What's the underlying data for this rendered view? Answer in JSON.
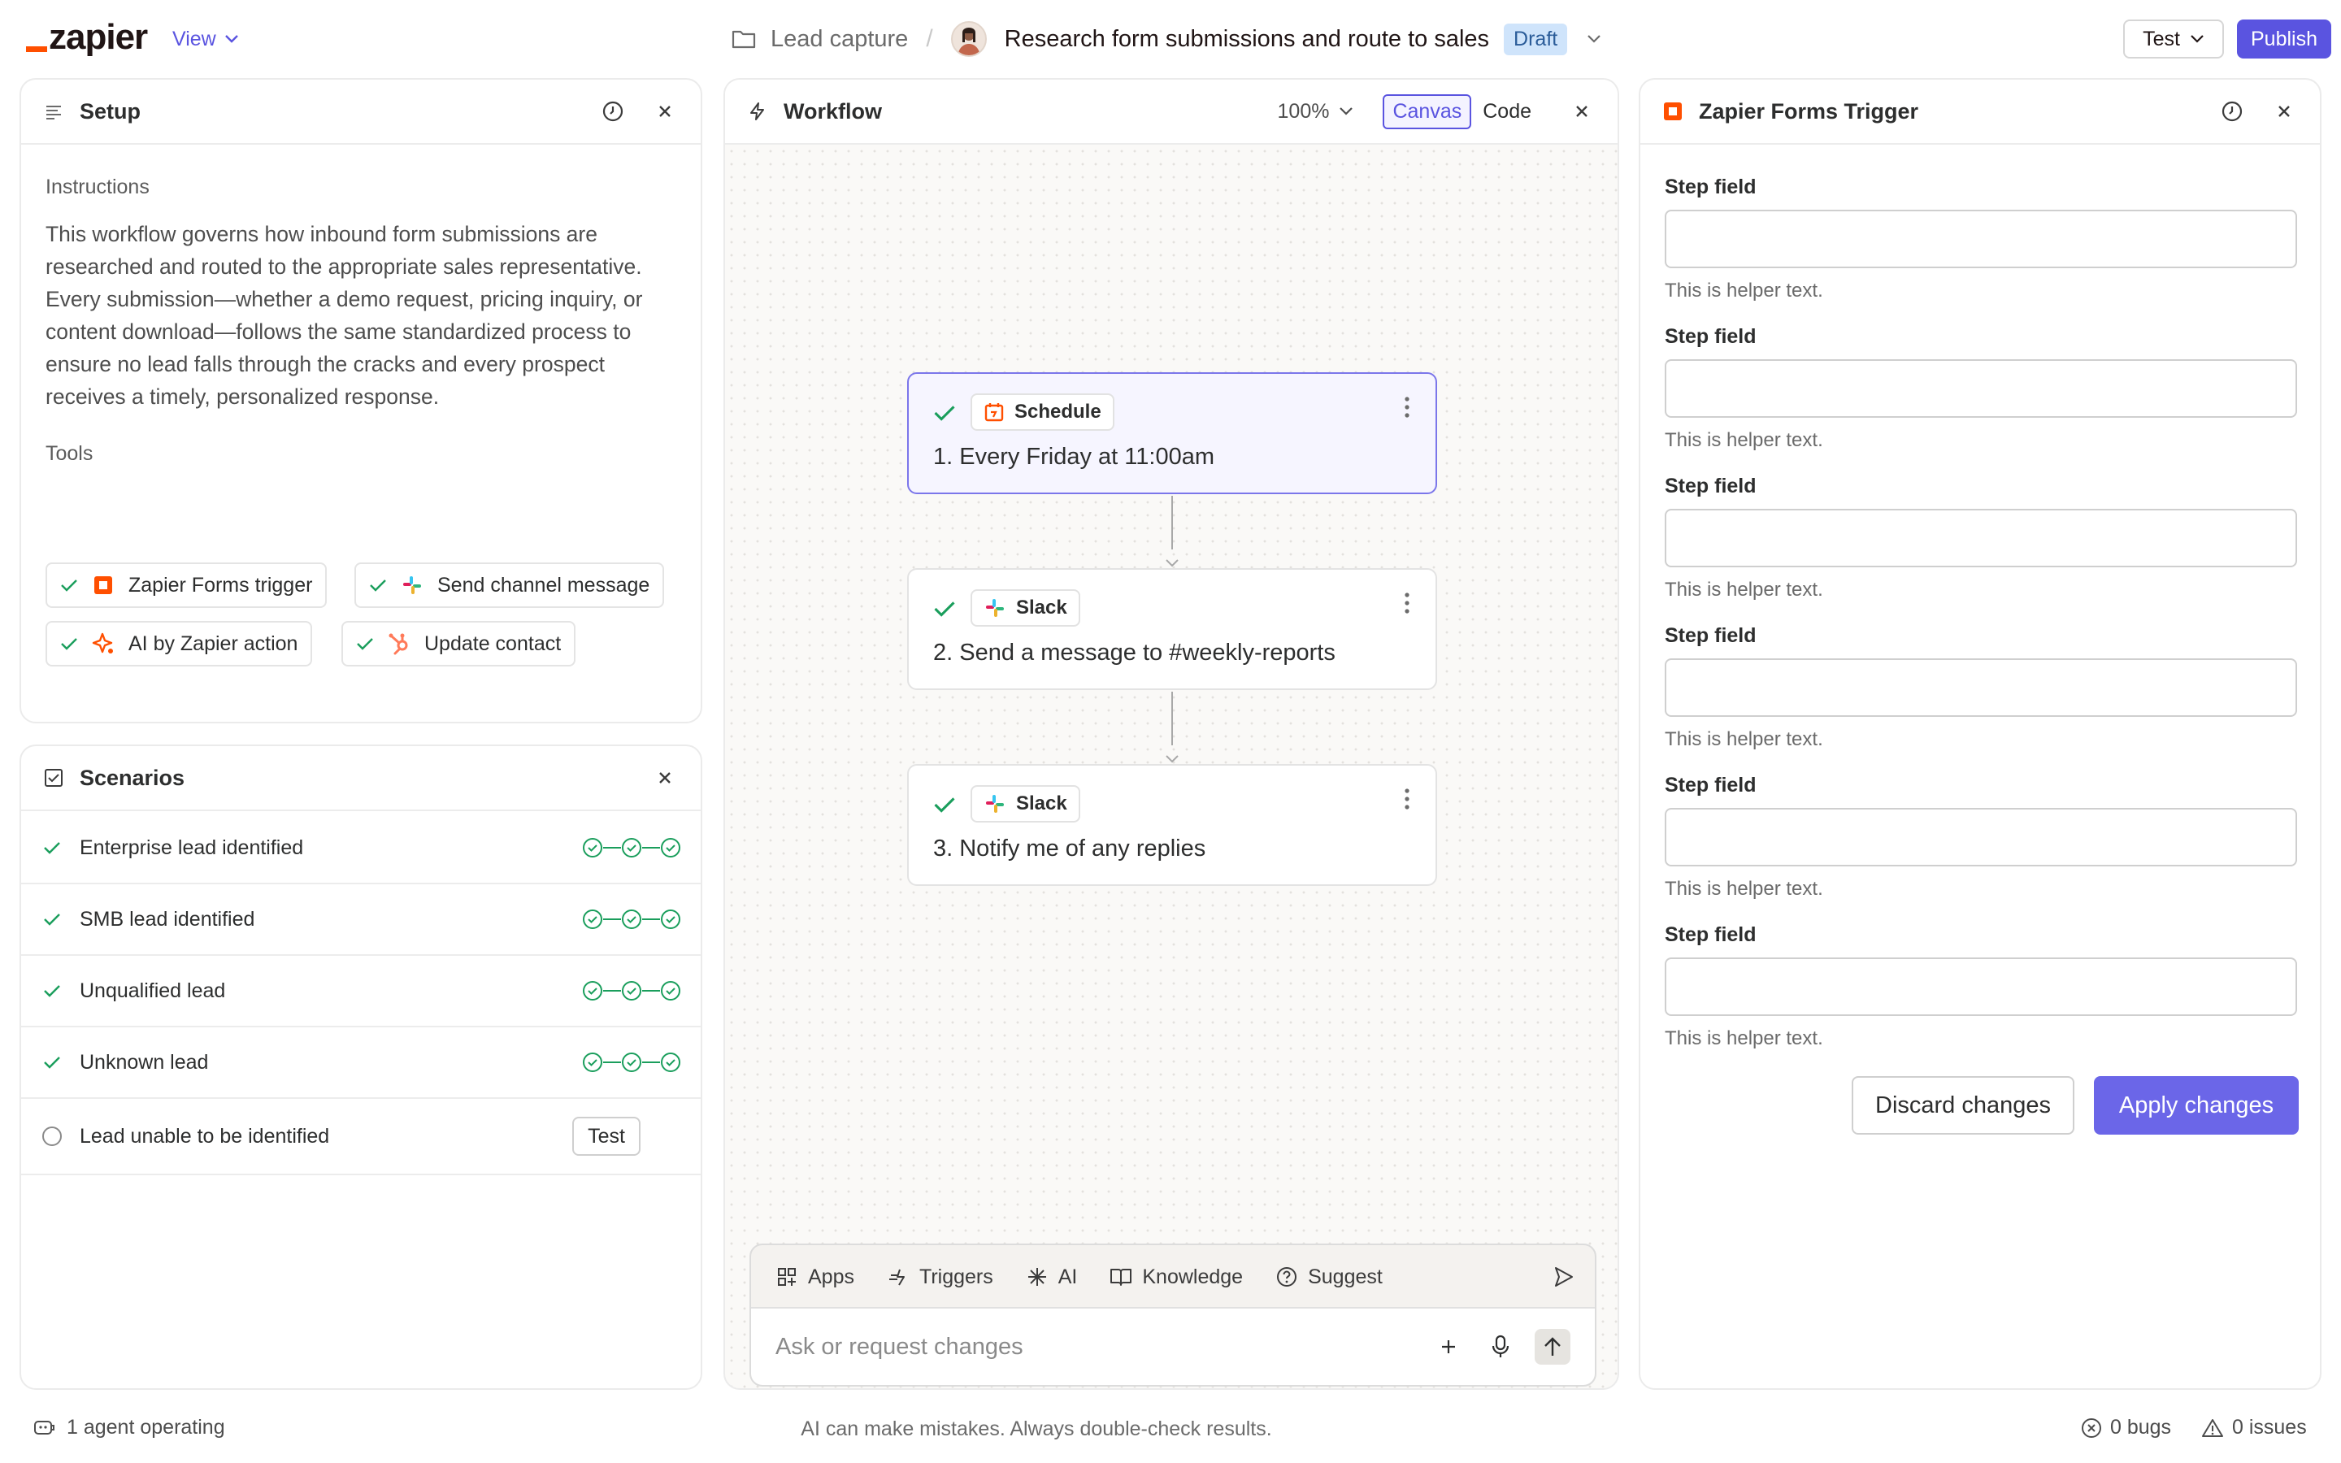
{
  "header": {
    "logo_text": "zapier",
    "view_label": "View",
    "breadcrumb_folder": "Lead capture",
    "workflow_title": "Research form submissions and route to sales",
    "status_badge": "Draft",
    "test_label": "Test",
    "publish_label": "Publish"
  },
  "setup": {
    "title": "Setup",
    "instructions_label": "Instructions",
    "instructions_text": "This workflow governs how inbound form submissions are researched and routed to the appropriate sales representative. Every submission—whether a demo request, pricing inquiry, or content download—follows the same standardized process to ensure no lead falls through the cracks and every prospect receives a timely, personalized response.",
    "tools_label": "Tools",
    "tools": [
      {
        "label": "Zapier Forms trigger",
        "icon": "zapier-forms-icon"
      },
      {
        "label": "Send channel message",
        "icon": "slack-icon"
      },
      {
        "label": "AI by Zapier action",
        "icon": "ai-zapier-icon"
      },
      {
        "label": "Update contact",
        "icon": "hubspot-icon"
      }
    ]
  },
  "scenarios": {
    "title": "Scenarios",
    "items": [
      {
        "label": "Enterprise lead identified",
        "status": "passed"
      },
      {
        "label": "SMB lead identified",
        "status": "passed"
      },
      {
        "label": "Unqualified lead",
        "status": "passed"
      },
      {
        "label": "Unknown lead",
        "status": "passed"
      },
      {
        "label": "Lead unable to be identified",
        "status": "untested",
        "action": "Test"
      }
    ]
  },
  "workflow": {
    "title": "Workflow",
    "zoom": "100%",
    "view_canvas": "Canvas",
    "view_code": "Code",
    "steps": [
      {
        "app": "Schedule",
        "text": "1. Every Friday at 11:00am",
        "selected": true
      },
      {
        "app": "Slack",
        "text": "2. Send a message to #weekly-reports",
        "selected": false
      },
      {
        "app": "Slack",
        "text": "3. Notify me of any replies",
        "selected": false
      }
    ],
    "chat": {
      "tabs": [
        "Apps",
        "Triggers",
        "AI",
        "Knowledge",
        "Suggest"
      ],
      "placeholder": "Ask or request changes"
    }
  },
  "trigger_panel": {
    "title": "Zapier Forms Trigger",
    "fields": [
      {
        "label": "Step field",
        "value": "",
        "helper": "This is helper text."
      },
      {
        "label": "Step field",
        "value": "",
        "helper": "This is helper text."
      },
      {
        "label": "Step field",
        "value": "",
        "helper": "This is helper text."
      },
      {
        "label": "Step field",
        "value": "",
        "helper": "This is helper text."
      },
      {
        "label": "Step field",
        "value": "",
        "helper": "This is helper text."
      },
      {
        "label": "Step field",
        "value": "",
        "helper": "This is helper text."
      }
    ],
    "discard_label": "Discard changes",
    "apply_label": "Apply changes"
  },
  "footer": {
    "agents": "1 agent operating",
    "disclaimer": "AI can make mistakes. Always double-check results.",
    "bugs": "0 bugs",
    "issues": "0 issues"
  },
  "colors": {
    "accent": "#5a54e0",
    "brand_orange": "#ff4f00",
    "success": "#1a9e5c",
    "draft_bg": "#cfe4fb"
  }
}
